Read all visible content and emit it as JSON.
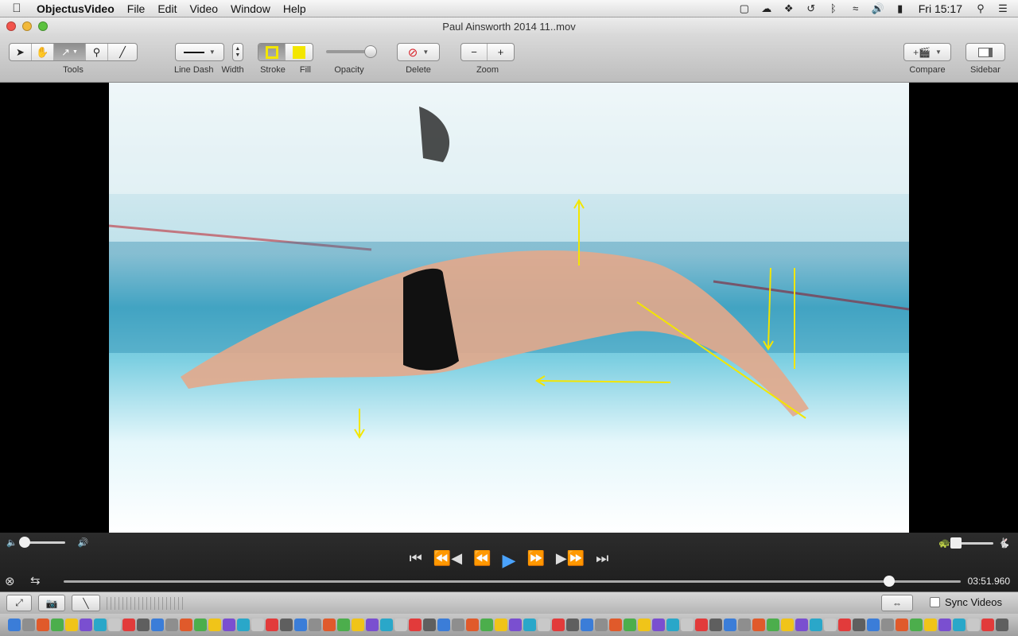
{
  "menubar": {
    "app_name": "ObjectusVideo",
    "items": [
      "File",
      "Edit",
      "Video",
      "Window",
      "Help"
    ],
    "clock": "Fri 15:17"
  },
  "window": {
    "title": "Paul Ainsworth 2014 11..mov"
  },
  "toolbar": {
    "tools_label": "Tools",
    "line_dash_label": "Line Dash",
    "width_label": "Width",
    "stroke_label": "Stroke",
    "fill_label": "Fill",
    "opacity_label": "Opacity",
    "delete_label": "Delete",
    "zoom_label": "Zoom",
    "compare_label": "Compare",
    "sidebar_label": "Sidebar",
    "stroke_color": "#f3e600",
    "fill_color": "#f3e600",
    "opacity_value": 1.0
  },
  "annotations": {
    "color": "#f3e600"
  },
  "player": {
    "timecode": "03:51.960",
    "position_fraction": 0.92,
    "volume_fraction": 0.0
  },
  "bottombar": {
    "sync_label": "Sync Videos",
    "sync_checked": false
  }
}
